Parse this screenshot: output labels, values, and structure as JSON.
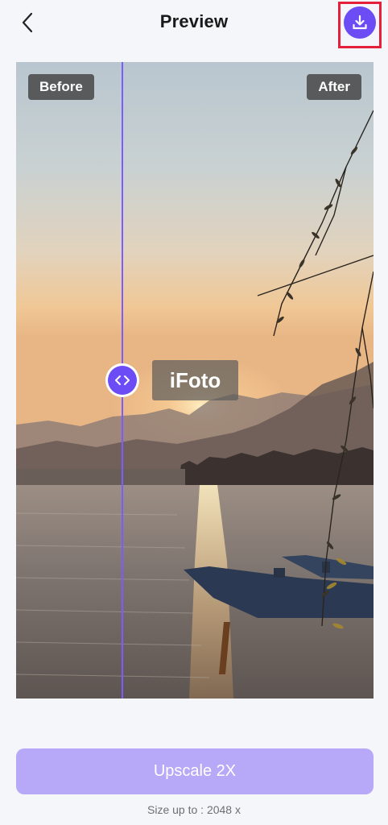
{
  "header": {
    "title": "Preview",
    "back_icon": "chevron-left-icon",
    "download_icon": "download-icon"
  },
  "compare": {
    "before_label": "Before",
    "after_label": "After",
    "watermark": "iFoto",
    "handle_icon": "code-arrows-icon",
    "divider_position_fraction": 0.297
  },
  "actions": {
    "upscale_label": "Upscale 2X",
    "size_note": "Size up to : 2048 x"
  },
  "colors": {
    "accent": "#6b4cf5",
    "upscale_disabled": "#b7a9f7",
    "highlight": "#e5203a"
  }
}
